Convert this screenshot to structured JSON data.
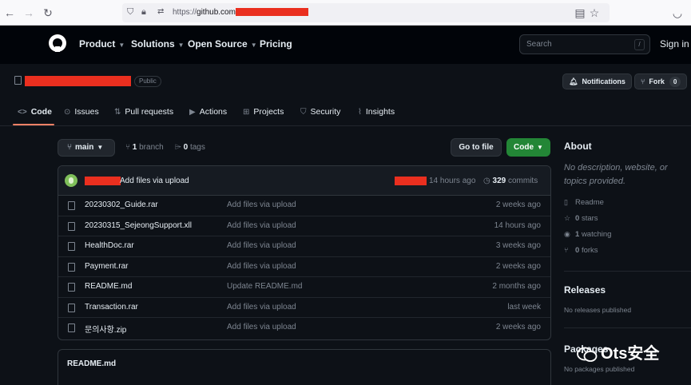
{
  "browser": {
    "url_prefix": "https://",
    "url_host": "github.com"
  },
  "header": {
    "nav": [
      "Product",
      "Solutions",
      "Open Source",
      "Pricing"
    ],
    "search_placeholder": "Search",
    "search_key": "/",
    "sign_in": "Sign in"
  },
  "repo": {
    "visibility": "Public",
    "notifications_label": "Notifications",
    "fork_label": "Fork",
    "fork_count": "0"
  },
  "tabs": [
    {
      "icon": "<>",
      "label": "Code"
    },
    {
      "icon": "⊙",
      "label": "Issues"
    },
    {
      "icon": "⇅",
      "label": "Pull requests"
    },
    {
      "icon": "▶",
      "label": "Actions"
    },
    {
      "icon": "⊞",
      "label": "Projects"
    },
    {
      "icon": "⛉",
      "label": "Security"
    },
    {
      "icon": "⌇",
      "label": "Insights"
    }
  ],
  "branch": {
    "name": "main",
    "branch_count": "1",
    "branch_label": "branch",
    "tag_count": "0",
    "tag_label": "tags",
    "goto_label": "Go to file",
    "code_label": "Code"
  },
  "commit": {
    "message": "Add files via upload",
    "time": "14 hours ago",
    "count": "329",
    "count_label": "commits"
  },
  "files": [
    {
      "name": "20230302_Guide.rar",
      "message": "Add files via upload",
      "age": "2 weeks ago"
    },
    {
      "name": "20230315_SejeongSupport.xll",
      "message": "Add files via upload",
      "age": "14 hours ago"
    },
    {
      "name": "HealthDoc.rar",
      "message": "Add files via upload",
      "age": "3 weeks ago"
    },
    {
      "name": "Payment.rar",
      "message": "Add files via upload",
      "age": "2 weeks ago"
    },
    {
      "name": "README.md",
      "message": "Update README.md",
      "age": "2 months ago"
    },
    {
      "name": "Transaction.rar",
      "message": "Add files via upload",
      "age": "last week"
    },
    {
      "name": "문의사항.zip",
      "message": "Add files via upload",
      "age": "2 weeks ago"
    }
  ],
  "readme_title": "README.md",
  "sidebar": {
    "about_title": "About",
    "description": "No description, website, or topics provided.",
    "readme": "Readme",
    "stars_count": "0",
    "stars_label": "stars",
    "watching_count": "1",
    "watching_label": "watching",
    "forks_count": "0",
    "forks_label": "forks",
    "releases_title": "Releases",
    "releases_text": "No releases published",
    "packages_title": "Packages",
    "packages_text": "No packages published"
  },
  "watermark": "Ots安全",
  "colors": {
    "bg": "#0d1117",
    "header_bg": "#010409",
    "accent_green": "#238636",
    "tab_underline": "#f78166",
    "redaction": "#ea2f1f"
  }
}
